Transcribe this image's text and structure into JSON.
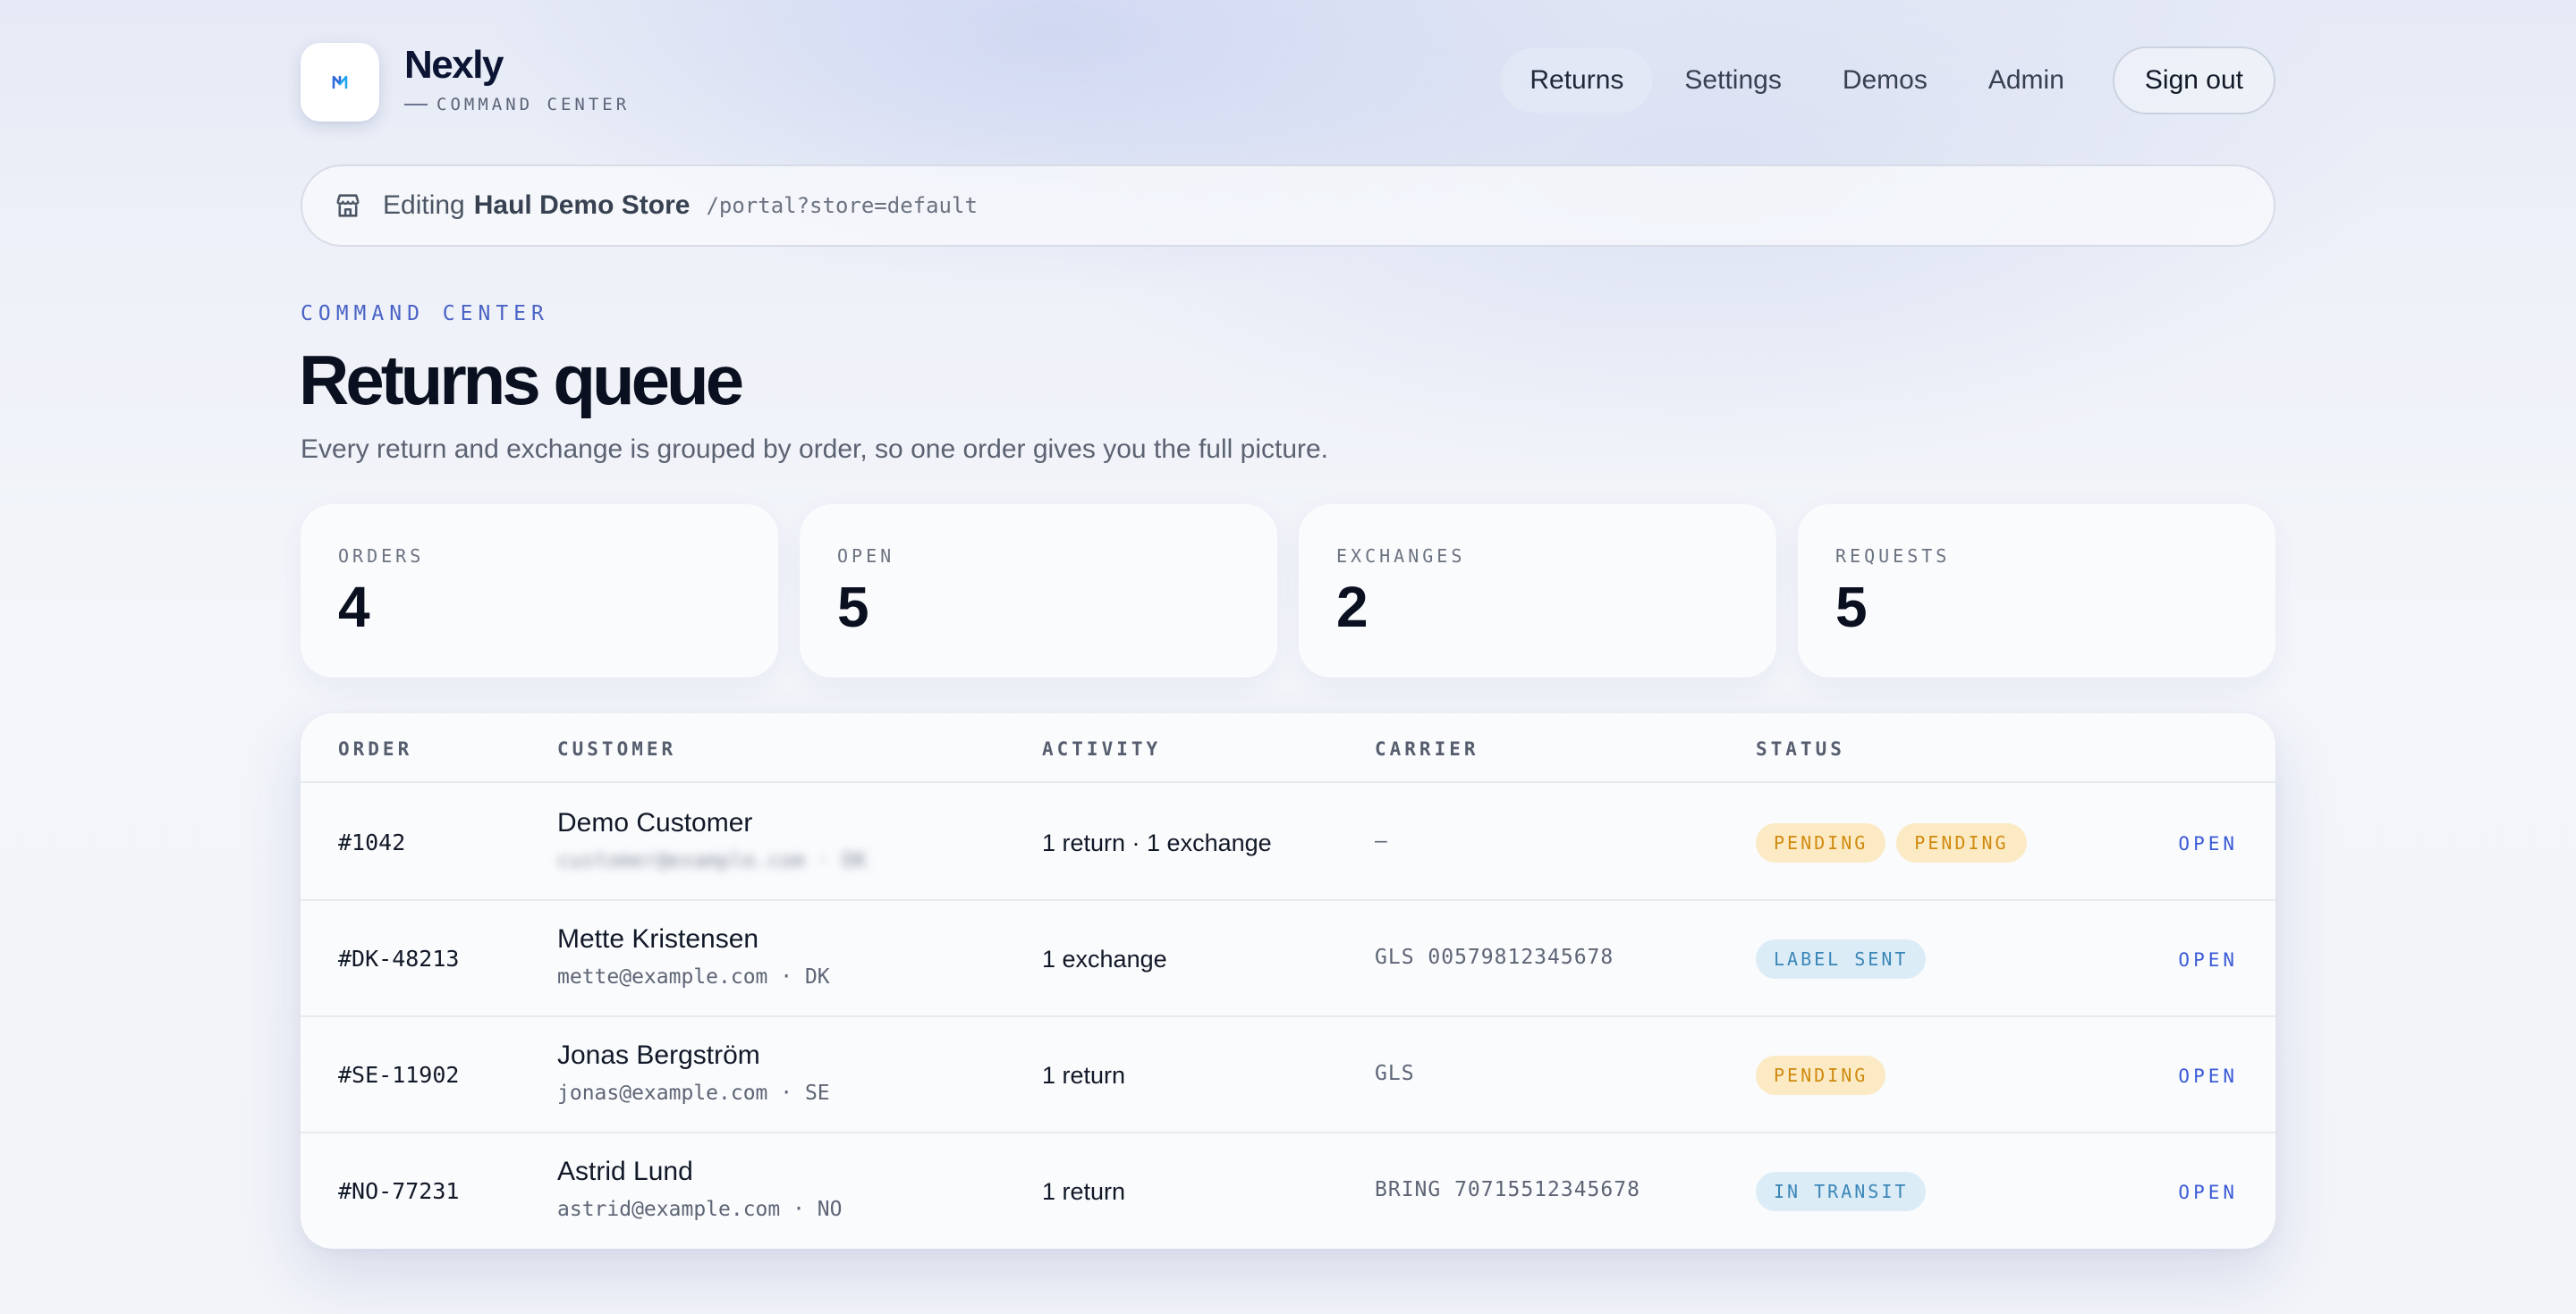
{
  "brand": {
    "name": "Nexly",
    "subtitle": "COMMAND CENTER",
    "logo_icon": "nexly-logo-icon"
  },
  "nav": {
    "items": [
      {
        "label": "Returns",
        "active": true
      },
      {
        "label": "Settings",
        "active": false
      },
      {
        "label": "Demos",
        "active": false
      },
      {
        "label": "Admin",
        "active": false
      }
    ],
    "sign_out": "Sign out"
  },
  "editing_bar": {
    "icon": "store-icon",
    "prefix": "Editing",
    "store_name": "Haul Demo Store",
    "path": "/portal?store=default"
  },
  "page": {
    "eyebrow": "COMMAND CENTER",
    "title": "Returns queue",
    "subtitle": "Every return and exchange is grouped by order, so one order gives you the full picture."
  },
  "stats": [
    {
      "label": "ORDERS",
      "value": "4"
    },
    {
      "label": "OPEN",
      "value": "5"
    },
    {
      "label": "EXCHANGES",
      "value": "2"
    },
    {
      "label": "REQUESTS",
      "value": "5"
    }
  ],
  "table": {
    "columns": {
      "order": "ORDER",
      "customer": "CUSTOMER",
      "activity": "ACTIVITY",
      "carrier": "CARRIER",
      "status": "STATUS"
    },
    "rows": [
      {
        "order": "#1042",
        "customer_name": "Demo Customer",
        "customer_meta": "customer@example.com · DK",
        "activity": "1 return · 1 exchange",
        "carrier": "—",
        "statuses": [
          {
            "label": "PENDING",
            "kind": "pending"
          },
          {
            "label": "PENDING",
            "kind": "pending"
          }
        ],
        "action": "OPEN"
      },
      {
        "order": "#DK-48213",
        "customer_name": "Mette Kristensen",
        "customer_meta": "mette@example.com · DK",
        "activity": "1 exchange",
        "carrier": "GLS 00579812345678",
        "statuses": [
          {
            "label": "LABEL SENT",
            "kind": "label-sent"
          }
        ],
        "action": "OPEN"
      },
      {
        "order": "#SE-11902",
        "customer_name": "Jonas Bergström",
        "customer_meta": "jonas@example.com · SE",
        "activity": "1 return",
        "carrier": "GLS",
        "statuses": [
          {
            "label": "PENDING",
            "kind": "pending"
          }
        ],
        "action": "OPEN"
      },
      {
        "order": "#NO-77231",
        "customer_name": "Astrid Lund",
        "customer_meta": "astrid@example.com · NO",
        "activity": "1 return",
        "carrier": "BRING 70715512345678",
        "statuses": [
          {
            "label": "IN TRANSIT",
            "kind": "in-transit"
          }
        ],
        "action": "OPEN"
      }
    ]
  },
  "colors": {
    "accent": "#3b5bd6",
    "pending_bg": "#fbeac4",
    "pending_text": "#d08a0e",
    "info_bg": "#dcecf6",
    "info_text": "#3a86b8"
  }
}
